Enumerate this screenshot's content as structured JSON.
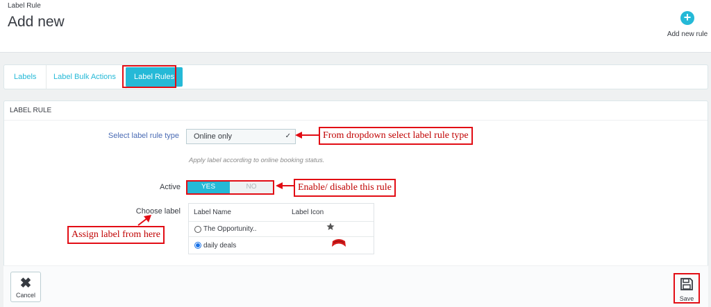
{
  "header": {
    "breadcrumb": "Label Rule",
    "title": "Add new",
    "add_rule_label": "Add new rule"
  },
  "tabs": [
    {
      "label": "Labels"
    },
    {
      "label": "Label Bulk Actions"
    },
    {
      "label": "Label Rules",
      "active": true
    }
  ],
  "panel": {
    "heading": "LABEL RULE",
    "rule_type": {
      "label": "Select label rule type",
      "value": "Online only",
      "help": "Apply label according to online booking status."
    },
    "active": {
      "label": "Active",
      "yes": "YES",
      "no": "NO",
      "value": true
    },
    "choose_label": {
      "label": "Choose label",
      "columns": [
        "Label Name",
        "Label Icon"
      ],
      "rows": [
        {
          "name": "The Opportunity..",
          "icon": "star-icon",
          "selected": false
        },
        {
          "name": "daily deals",
          "icon": "red-ribbon-icon",
          "selected": true
        }
      ]
    }
  },
  "footer": {
    "cancel_label": "Cancel",
    "save_label": "Save"
  },
  "annotations": {
    "dropdown": "From dropdown select label rule type",
    "toggle": "Enable/ disable this rule",
    "assign": "Assign label from here"
  },
  "colors": {
    "accent": "#25b9d7",
    "annotation_red": "#e20c14"
  }
}
